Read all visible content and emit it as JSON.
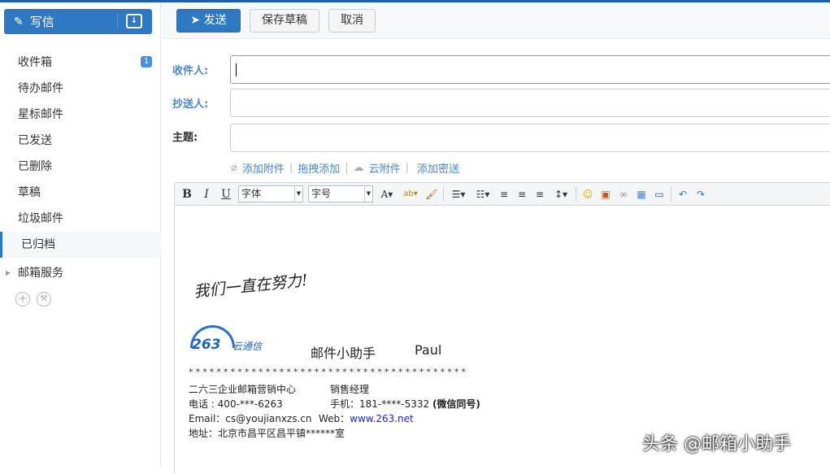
{
  "sidebar": {
    "compose_label": "写信",
    "items": [
      {
        "label": "收件箱",
        "badge": "1"
      },
      {
        "label": "待办邮件"
      },
      {
        "label": "星标邮件"
      },
      {
        "label": "已发送"
      },
      {
        "label": "已删除"
      },
      {
        "label": "草稿"
      },
      {
        "label": "垃圾邮件"
      },
      {
        "label": "已归档"
      }
    ],
    "service_label": "邮箱服务"
  },
  "toolbar": {
    "send_label": "发送",
    "save_label": "保存草稿",
    "cancel_label": "取消"
  },
  "form": {
    "to_label": "收件人:",
    "to_value": "",
    "cc_label": "抄送人:",
    "cc_value": "",
    "subject_label": "主题:",
    "subject_value": "",
    "links": [
      "添加附件",
      "拖拽添加",
      "云附件",
      "添加密送"
    ]
  },
  "editor_toolbar": {
    "font": "字体",
    "size": "字号"
  },
  "signature": {
    "handwritten": "我们一直在努力!",
    "logo_text": "263云通信",
    "name_cn": "邮件小助手",
    "name_en": "Paul",
    "stars": "****************************************",
    "company": "二六三企业邮箱营销中心",
    "title": "销售经理",
    "phone": "电话 : 400-***-6263",
    "mobile": "手机：181-****-5332",
    "mobile_note": "(微信同号)",
    "email": "Email：cs@youjianxzs.cn",
    "web_label": "Web：",
    "web_link": "www.263.net",
    "address": "地址：北京市昌平区昌平镇******室"
  },
  "watermark": "头条 @邮箱小助手"
}
